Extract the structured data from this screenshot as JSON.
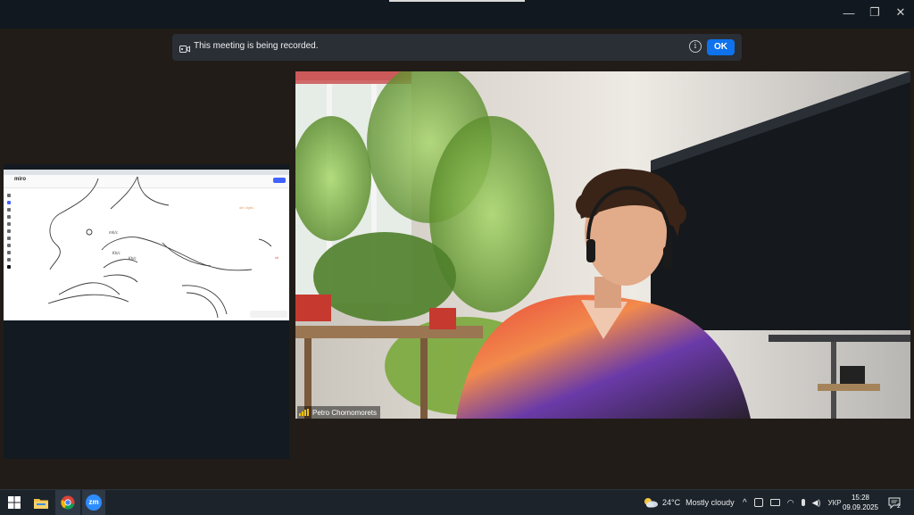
{
  "window": {
    "minimize": "—",
    "restore": "❐",
    "close": "✕"
  },
  "banner": {
    "message": "This meeting is being recorded.",
    "info": "i",
    "ok_label": "OK"
  },
  "shared_screen": {
    "app_logo": "miro",
    "annotation_1": "dle ölgtis",
    "annotation_2": "slt"
  },
  "video": {
    "participant_name": "Petro Chornomorets"
  },
  "taskbar": {
    "apps": [
      "start-icon",
      "file-explorer-icon",
      "chrome-icon",
      "zoom-icon"
    ],
    "zoom_label": "zm",
    "weather_temp": "24°C",
    "weather_desc": "Mostly cloudy",
    "language": "УКР",
    "time": "15:28",
    "date": "09.09.2025",
    "notification_count": "2"
  },
  "colors": {
    "accent": "#0e72ed",
    "signal": "#f5c400",
    "taskbar": "#1c232b"
  }
}
